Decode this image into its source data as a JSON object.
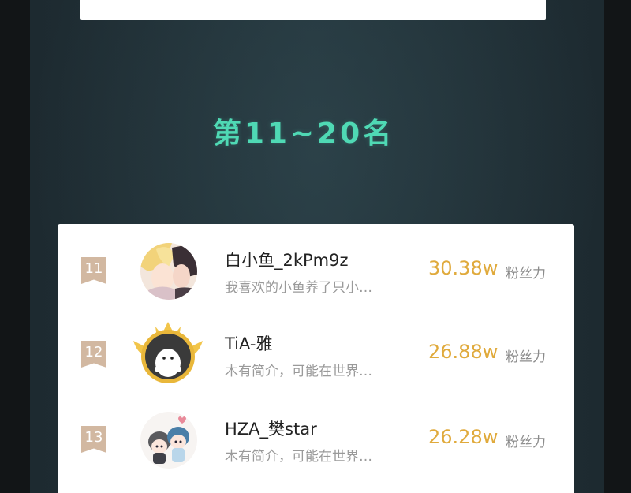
{
  "header": {
    "section_title": "第11~20名"
  },
  "ranking": {
    "score_label": "粉丝力",
    "rows": [
      {
        "rank": "11",
        "name": "白小鱼_2kPm9z",
        "bio": "我喜欢的小鱼养了只小…",
        "score": "30.38w",
        "avatar_icon": "anime-couple-avatar"
      },
      {
        "rank": "12",
        "name": "TiA-雅",
        "bio": "木有简介，可能在世界…",
        "score": "26.88w",
        "avatar_icon": "crowned-blob-avatar"
      },
      {
        "rank": "13",
        "name": "HZA_樊star",
        "bio": "木有简介，可能在世界…",
        "score": "26.28w",
        "avatar_icon": "chibi-duo-avatar"
      }
    ]
  },
  "colors": {
    "title": "#4fd9b4",
    "score": "#e0aa3c",
    "rank_badge": "#d2b8a1",
    "background": "#1d2a30"
  }
}
